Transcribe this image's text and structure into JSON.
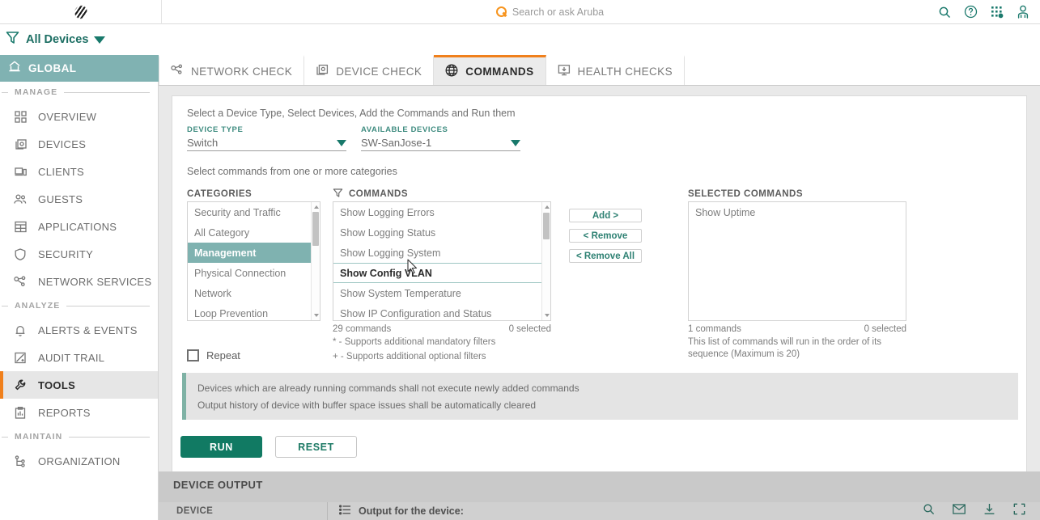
{
  "topbar": {
    "logo_name": "aruba-logo",
    "search_placeholder": "Search or ask Aruba",
    "icons": [
      "search-icon",
      "help-icon",
      "apps-grid-icon",
      "user-account-icon"
    ]
  },
  "filter": {
    "label": "All Devices",
    "icon": "filter-funnel-icon"
  },
  "sidebar": {
    "global_label": "GLOBAL",
    "sections": [
      {
        "title": "MANAGE",
        "items": [
          {
            "label": "OVERVIEW",
            "icon": "grid-overview-icon",
            "active": false
          },
          {
            "label": "DEVICES",
            "icon": "devices-icon",
            "active": false
          },
          {
            "label": "CLIENTS",
            "icon": "clients-icon",
            "active": false
          },
          {
            "label": "GUESTS",
            "icon": "guests-icon",
            "active": false
          },
          {
            "label": "APPLICATIONS",
            "icon": "applications-icon",
            "active": false
          },
          {
            "label": "SECURITY",
            "icon": "shield-icon",
            "active": false
          },
          {
            "label": "NETWORK SERVICES",
            "icon": "network-services-icon",
            "active": false
          }
        ]
      },
      {
        "title": "ANALYZE",
        "items": [
          {
            "label": "ALERTS & EVENTS",
            "icon": "bell-icon",
            "active": false
          },
          {
            "label": "AUDIT TRAIL",
            "icon": "audit-trail-icon",
            "active": false
          },
          {
            "label": "TOOLS",
            "icon": "wrench-icon",
            "active": true
          },
          {
            "label": "REPORTS",
            "icon": "reports-icon",
            "active": false
          }
        ]
      },
      {
        "title": "MAINTAIN",
        "items": [
          {
            "label": "ORGANIZATION",
            "icon": "organization-tree-icon",
            "active": false
          }
        ]
      }
    ]
  },
  "tabs": [
    {
      "label": "NETWORK CHECK",
      "icon": "network-check-icon",
      "active": false
    },
    {
      "label": "DEVICE CHECK",
      "icon": "device-check-icon",
      "active": false
    },
    {
      "label": "COMMANDS",
      "icon": "globe-icon",
      "active": true
    },
    {
      "label": "HEALTH CHECKS",
      "icon": "health-checks-icon",
      "active": false
    }
  ],
  "form": {
    "title": "Select a Device Type, Select Devices, Add the Commands and Run them",
    "device_type": {
      "label": "DEVICE TYPE",
      "value": "Switch"
    },
    "available_devices": {
      "label": "AVAILABLE DEVICES",
      "value": "SW-SanJose-1"
    },
    "sub_title": "Select commands from one or more categories",
    "categories": {
      "header": "CATEGORIES",
      "items": [
        {
          "label": "Security and Traffic",
          "state": "normal"
        },
        {
          "label": "All Category",
          "state": "normal"
        },
        {
          "label": "Management",
          "state": "selected"
        },
        {
          "label": "Physical Connection",
          "state": "normal"
        },
        {
          "label": "Network",
          "state": "normal"
        },
        {
          "label": "Loop Prevention",
          "state": "normal"
        }
      ]
    },
    "commands": {
      "header": "COMMANDS",
      "filter_icon": "filter-funnel-icon",
      "items": [
        {
          "label": "Show Logging Errors",
          "state": "normal"
        },
        {
          "label": "Show Logging Status",
          "state": "normal"
        },
        {
          "label": "Show Logging System",
          "state": "normal"
        },
        {
          "label": "Show Config VLAN",
          "state": "hover"
        },
        {
          "label": "Show System Temperature",
          "state": "normal"
        },
        {
          "label": "Show IP Configuration and Status",
          "state": "normal"
        }
      ],
      "count_text": "29 commands",
      "selected_text": "0 selected",
      "legend_mandatory": "* - Supports additional mandatory filters",
      "legend_optional": "+ - Supports additional optional filters"
    },
    "transfer_buttons": [
      {
        "label": "Add >",
        "name": "add-button"
      },
      {
        "label": "< Remove",
        "name": "remove-button"
      },
      {
        "label": "< Remove All",
        "name": "remove-all-button"
      }
    ],
    "selected_commands": {
      "header": "SELECTED COMMANDS",
      "items": [
        {
          "label": "Show Uptime"
        }
      ],
      "count_text": "1 commands",
      "selected_text": "0 selected",
      "note": "This list of commands will run in the order of its sequence (Maximum is 20)"
    },
    "repeat": {
      "label": "Repeat",
      "checked": false
    },
    "info": {
      "line1": "Devices which are already running commands shall not execute newly added commands",
      "line2": "Output history of device with buffer space issues shall be automatically cleared"
    },
    "run_label": "RUN",
    "reset_label": "RESET"
  },
  "device_output": {
    "title": "DEVICE OUTPUT",
    "device_column": "DEVICE",
    "output_header": "Output for the device:",
    "icons": [
      "search-icon",
      "mail-icon",
      "download-icon",
      "fullscreen-icon"
    ]
  }
}
